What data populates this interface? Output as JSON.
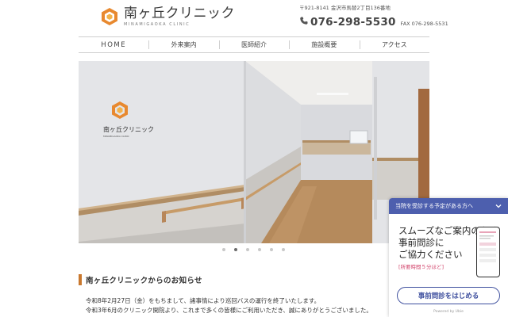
{
  "header": {
    "logo_name": "南ヶ丘クリニック",
    "logo_sub": "MINAMIGAOKA CLINIC",
    "address": "〒921-8141 金沢市馬替2丁目136番地",
    "phone": "076-298-5530",
    "fax": "FAX 076-298-5531",
    "accent_color": "#e8892f"
  },
  "nav": {
    "items": [
      {
        "label": "HOME"
      },
      {
        "label": "外来案内"
      },
      {
        "label": "医師紹介"
      },
      {
        "label": "施設概要"
      },
      {
        "label": "アクセス"
      }
    ]
  },
  "slider": {
    "sign_name": "南ヶ丘クリニック",
    "sign_sub": "MINAMIGAOKA CLINIC",
    "dots": 6,
    "active_dot": 2
  },
  "news": {
    "heading": "南ヶ丘クリニックからのお知らせ",
    "lines": [
      "令和8年2月27日（金）をもちまして、諸事情により巡回バスの運行を終了いたします。",
      "令和3年6月のクリニック開院より、これまで多くの皆様にご利用いただき、誠にありがとうございました。"
    ],
    "bar_color": "#c9782e"
  },
  "widget": {
    "header": "当院を受診する予定がある方へ",
    "line1": "スムーズなご案内のため",
    "line2": "事前問診に",
    "line3": "ご協力ください",
    "note": "[所要時間５分ほど]",
    "button": "事前問診をはじめる",
    "powered": "Powered by Ubie",
    "header_color": "#4d5fae"
  }
}
